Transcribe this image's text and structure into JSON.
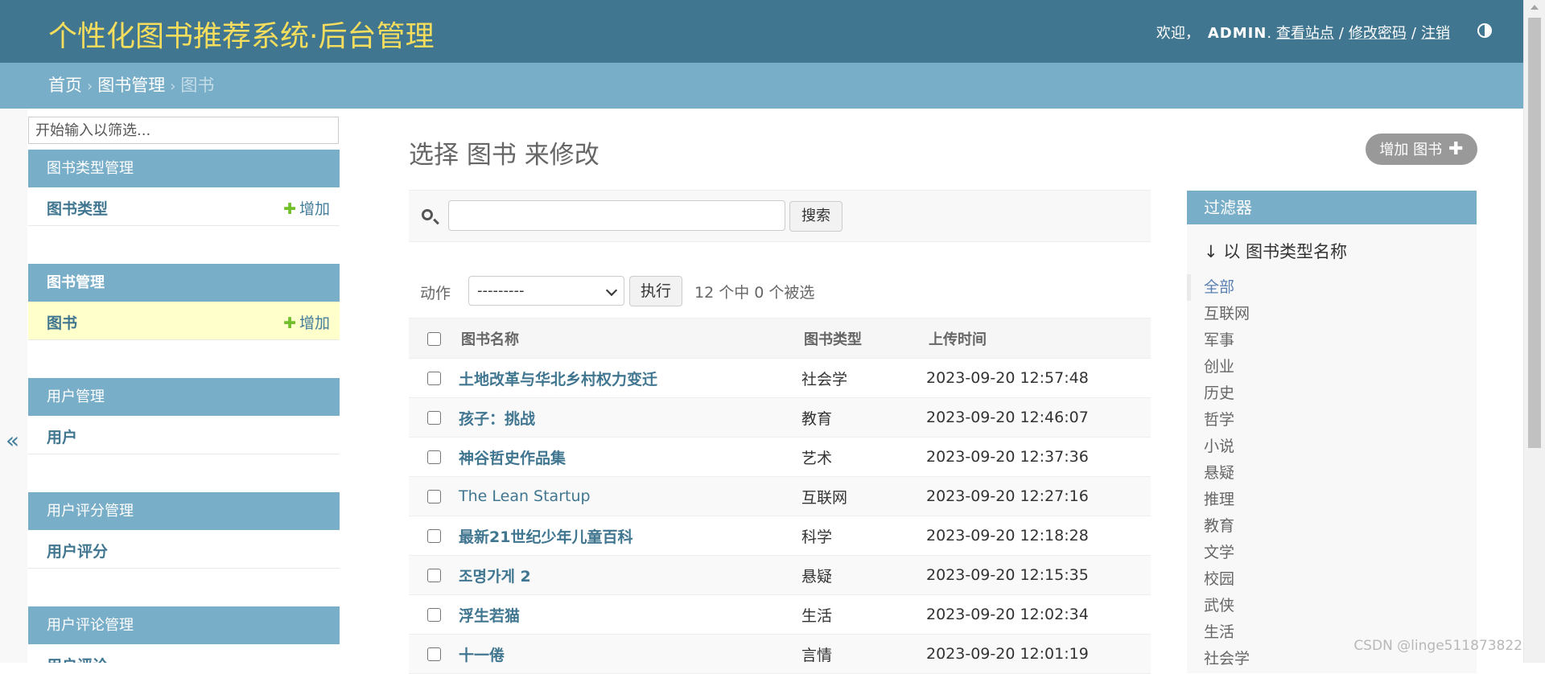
{
  "header": {
    "site_title": "个性化图书推荐系统·后台管理",
    "welcome": "欢迎，",
    "username": "ADMIN",
    "username_suffix": ".",
    "view_site": "查看站点",
    "change_password": "修改密码",
    "logout": "注销",
    "separator": "/",
    "theme_toggle_icon": "half-circle-contrast-icon"
  },
  "breadcrumbs": {
    "home": "首页",
    "app": "图书管理",
    "current": "图书",
    "arrow": "›"
  },
  "sidebar": {
    "collapse_label": "«",
    "filter_placeholder": "开始输入以筛选...",
    "modules": [
      {
        "caption": "图书类型管理",
        "rows": [
          {
            "name": "图书类型",
            "add": "增加",
            "current": false
          }
        ]
      },
      {
        "caption": "图书管理",
        "rows": [
          {
            "name": "图书",
            "add": "增加",
            "current": true
          }
        ]
      },
      {
        "caption": "用户管理",
        "rows": [
          {
            "name": "用户",
            "add": "",
            "current": false
          }
        ]
      },
      {
        "caption": "用户评分管理",
        "rows": [
          {
            "name": "用户评分",
            "add": "",
            "current": false
          }
        ]
      },
      {
        "caption": "用户评论管理",
        "rows": [
          {
            "name": "用户评论",
            "add": "",
            "current": false
          }
        ]
      }
    ]
  },
  "content": {
    "title": "选择 图书 来修改",
    "add_button": "增加 图书",
    "add_button_icon": "plus-icon",
    "search": {
      "value": "",
      "button": "搜索",
      "icon": "search-icon"
    },
    "actions": {
      "label": "动作",
      "selected_option": "---------",
      "go_button": "执行",
      "counter": "12 个中 0 个被选"
    },
    "table": {
      "headers": [
        "图书名称",
        "图书类型",
        "上传时间"
      ],
      "rows": [
        {
          "name": "土地改革与华北乡村权力变迁",
          "type": "社会学",
          "time": "2023-09-20 12:57:48"
        },
        {
          "name": "孩子：挑战",
          "type": "教育",
          "time": "2023-09-20 12:46:07"
        },
        {
          "name": "神谷哲史作品集",
          "type": "艺术",
          "time": "2023-09-20 12:37:36"
        },
        {
          "name": "The Lean Startup",
          "type": "互联网",
          "time": "2023-09-20 12:27:16"
        },
        {
          "name": "最新21世纪少年儿童百科",
          "type": "科学",
          "time": "2023-09-20 12:18:28"
        },
        {
          "name": "조명가게 2",
          "type": "悬疑",
          "time": "2023-09-20 12:15:35"
        },
        {
          "name": "浮生若猫",
          "type": "生活",
          "time": "2023-09-20 12:02:34"
        },
        {
          "name": "十一倦",
          "type": "言情",
          "time": "2023-09-20 12:01:19"
        }
      ]
    }
  },
  "filter": {
    "title": "过滤器",
    "heading": "↓ 以 图书类型名称",
    "options": [
      "全部",
      "互联网",
      "军事",
      "创业",
      "历史",
      "哲学",
      "小说",
      "悬疑",
      "推理",
      "教育",
      "文学",
      "校园",
      "武侠",
      "生活",
      "社会学"
    ],
    "selected": "全部"
  },
  "watermark": "CSDN @linge511873822",
  "colors": {
    "header_bg": "#417690",
    "title_yellow": "#f5dd5d",
    "breadcrumb_bg": "#79aec8",
    "link": "#417690",
    "add_green": "#70bf2b",
    "current_row": "#ffffcc"
  }
}
